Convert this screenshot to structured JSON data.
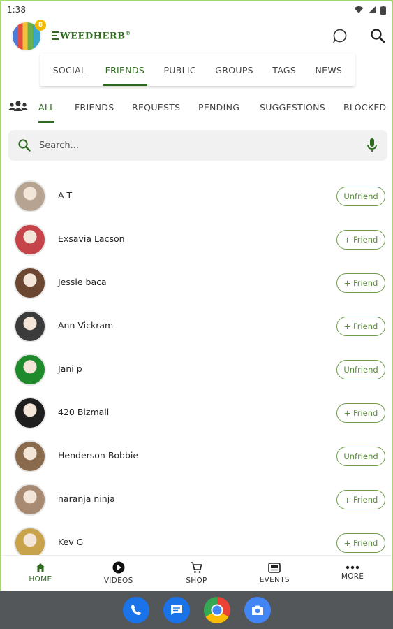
{
  "status_bar": {
    "time": "1:38"
  },
  "header": {
    "badge_count": "8",
    "logo_text": "WEEDHERB",
    "logo_mark": "®"
  },
  "top_tabs": [
    {
      "label": "SOCIAL"
    },
    {
      "label": "FRIENDS"
    },
    {
      "label": "PUBLIC"
    },
    {
      "label": "GROUPS"
    },
    {
      "label": "TAGS"
    },
    {
      "label": "NEWS"
    }
  ],
  "sub_tabs": [
    {
      "label": "ALL"
    },
    {
      "label": "FRIENDS"
    },
    {
      "label": "REQUESTS"
    },
    {
      "label": "PENDING"
    },
    {
      "label": "SUGGESTIONS"
    },
    {
      "label": "BLOCKED"
    }
  ],
  "search": {
    "placeholder": "Search..."
  },
  "friends": [
    {
      "name": "A T",
      "action": "Unfriend",
      "avatar_color": "#b7a391"
    },
    {
      "name": "Exsavia  Lacson",
      "action": "+ Friend",
      "avatar_color": "#c4444a"
    },
    {
      "name": "Jessie baca",
      "action": "+ Friend",
      "avatar_color": "#6b4631"
    },
    {
      "name": "Ann Vickram",
      "action": "+ Friend",
      "avatar_color": "#3b3b3b"
    },
    {
      "name": "Jani p",
      "action": "Unfriend",
      "avatar_color": "#1f8a2c"
    },
    {
      "name": "420 Bizmall",
      "action": "+ Friend",
      "avatar_color": "#1e1e1e"
    },
    {
      "name": "Henderson Bobbie",
      "action": "Unfriend",
      "avatar_color": "#8a6a4c"
    },
    {
      "name": "naranja ninja",
      "action": "+ Friend",
      "avatar_color": "#a88a72"
    },
    {
      "name": "Kev G",
      "action": "+ Friend",
      "avatar_color": "#c9a24c"
    }
  ],
  "bottom_nav": [
    {
      "label": "HOME"
    },
    {
      "label": "VIDEOS"
    },
    {
      "label": "SHOP"
    },
    {
      "label": "EVENTS"
    },
    {
      "label": "MORE"
    }
  ],
  "colors": {
    "accent": "#2e6b1f",
    "button_border": "#6f9d4f",
    "frame": "#a6d66e",
    "dock": "#54575a"
  }
}
